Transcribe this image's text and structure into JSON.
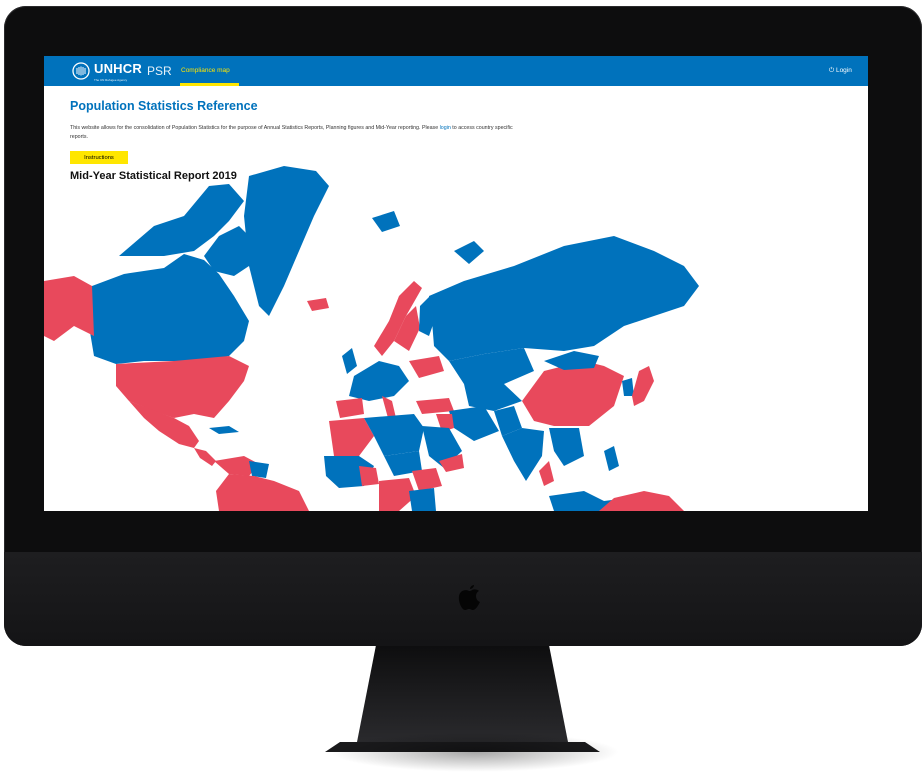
{
  "brand": {
    "name": "UNHCR",
    "tagline": "The UN Refugee Agency"
  },
  "nav": {
    "app_abbr": "PSR",
    "tab_compliance": "Compliance map",
    "login": "Login"
  },
  "page": {
    "title": "Population Statistics Reference",
    "intro_before_link": "This website allows for the consolidation of Population Statistics for the purpose of Annual Statistics Reports, Planning figures and Mid-Year reporting. Please ",
    "intro_link": "login",
    "intro_after_link": " to access country specific reports.",
    "instructions_button": "Instructions",
    "report_title": "Mid-Year Statistical Report 2019"
  },
  "colors": {
    "brand_blue": "#0072bc",
    "accent_yellow": "#ffe600",
    "map_compliant": "#0072bc",
    "map_noncompliant": "#e8495c"
  }
}
